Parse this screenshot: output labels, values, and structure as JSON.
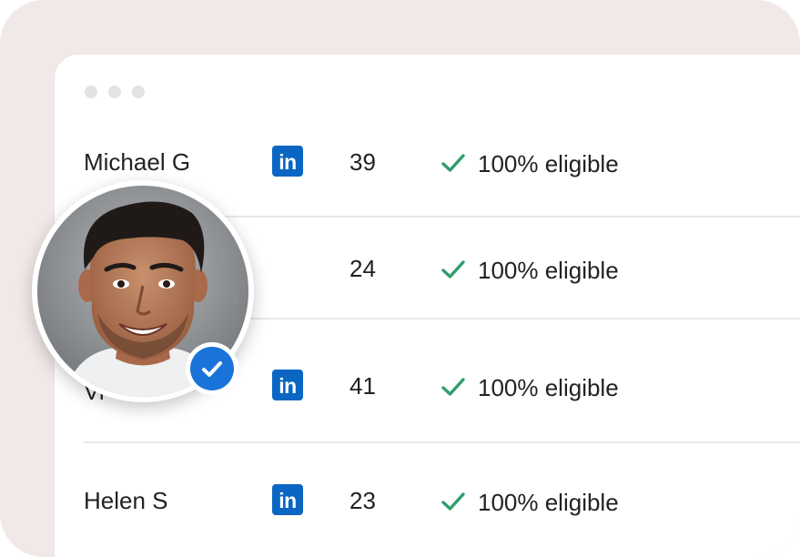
{
  "window": {
    "controls": [
      "window-dot",
      "window-dot",
      "window-dot"
    ]
  },
  "rows": [
    {
      "name": "Michael G",
      "linkedin": "in",
      "count": "39",
      "eligibility": "100% eligible"
    },
    {
      "name": "",
      "linkedin": "",
      "count": "24",
      "eligibility": "100% eligible"
    },
    {
      "name": "Vi",
      "linkedin": "in",
      "count": "41",
      "eligibility": "100% eligible"
    },
    {
      "name": "Helen S",
      "linkedin": "in",
      "count": "23",
      "eligibility": "100% eligible"
    }
  ],
  "colors": {
    "background": "#f1e9e8",
    "linkedin": "#0a66c2",
    "check": "#2e9e6b",
    "verified_badge": "#1a73d9"
  },
  "icons": {
    "linkedin": "linkedin-icon",
    "check": "check-icon",
    "verified": "verified-badge-icon"
  }
}
